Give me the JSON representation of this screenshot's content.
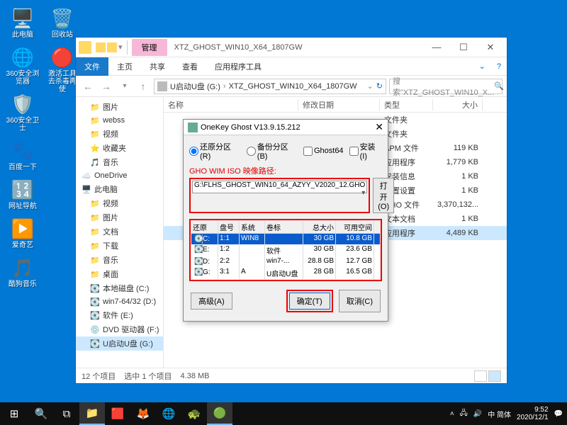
{
  "desktop": {
    "col1": [
      {
        "icon": "🖥️",
        "label": "此电脑"
      },
      {
        "icon": "🌐",
        "label": "360安全浏览器"
      },
      {
        "icon": "🛡️",
        "label": "360安全卫士"
      },
      {
        "icon": "🐾",
        "label": "百度一下"
      },
      {
        "icon": "🔢",
        "label": "网址导航"
      },
      {
        "icon": "▶️",
        "label": "爱奇艺"
      },
      {
        "icon": "🎵",
        "label": "酷狗音乐"
      }
    ],
    "col2": [
      {
        "icon": "🗑️",
        "label": "回收站"
      },
      {
        "icon": "🔴",
        "label": "激活工具去杀毒再使"
      }
    ]
  },
  "explorer": {
    "window_tab": "管理",
    "title": "XTZ_GHOST_WIN10_X64_1807GW",
    "ribbon": {
      "file": "文件",
      "tabs": [
        "主页",
        "共享",
        "查看",
        "应用程序工具"
      ]
    },
    "breadcrumb": [
      "U启动U盘 (G:)",
      "XTZ_GHOST_WIN10_X64_1807GW"
    ],
    "search_placeholder": "搜索\"XTZ_GHOST_WIN10_X...",
    "nav": [
      {
        "label": "图片",
        "ico": "folder",
        "indent": 1
      },
      {
        "label": "webss",
        "ico": "folder",
        "indent": 1
      },
      {
        "label": "视频",
        "ico": "folder",
        "indent": 1
      },
      {
        "label": "收藏夹",
        "ico": "star",
        "indent": 1
      },
      {
        "label": "音乐",
        "ico": "music",
        "indent": 1
      },
      {
        "label": "OneDrive",
        "ico": "cloud",
        "indent": 0,
        "group": true
      },
      {
        "label": "此电脑",
        "ico": "pc",
        "indent": 0,
        "group": true
      },
      {
        "label": "视频",
        "ico": "folder",
        "indent": 1
      },
      {
        "label": "图片",
        "ico": "folder",
        "indent": 1
      },
      {
        "label": "文档",
        "ico": "folder",
        "indent": 1
      },
      {
        "label": "下载",
        "ico": "folder",
        "indent": 1
      },
      {
        "label": "音乐",
        "ico": "folder",
        "indent": 1
      },
      {
        "label": "桌面",
        "ico": "folder",
        "indent": 1
      },
      {
        "label": "本地磁盘 (C:)",
        "ico": "disk",
        "indent": 1
      },
      {
        "label": "win7-64/32 (D:)",
        "ico": "disk",
        "indent": 1
      },
      {
        "label": "软件 (E:)",
        "ico": "disk",
        "indent": 1
      },
      {
        "label": "DVD 驱动器 (F:)",
        "ico": "dvd",
        "indent": 1
      },
      {
        "label": "U启动U盘 (G:)",
        "ico": "disk",
        "indent": 1,
        "selected": true
      }
    ],
    "columns": {
      "name": "名称",
      "date": "修改日期",
      "type": "类型",
      "size": "大小"
    },
    "files": [
      {
        "name": "",
        "date": "",
        "type": "文件夹",
        "size": ""
      },
      {
        "name": "",
        "date": "",
        "type": "文件夹",
        "size": ""
      },
      {
        "name": "",
        "date": "",
        "type": "APM 文件",
        "size": "119 KB"
      },
      {
        "name": "",
        "date": "",
        "type": "应用程序",
        "size": "1,779 KB"
      },
      {
        "name": "",
        "date": "",
        "type": "安装信息",
        "size": "1 KB"
      },
      {
        "name": "",
        "date": "",
        "type": "配置设置",
        "size": "1 KB"
      },
      {
        "name": "",
        "date": "",
        "type": "GHO 文件",
        "size": "3,370,132..."
      },
      {
        "name": "",
        "date": "",
        "type": "文本文档",
        "size": "1 KB"
      },
      {
        "name": "",
        "date": "",
        "type": "应用程序",
        "size": "4,489 KB",
        "selected": true
      }
    ],
    "status": {
      "count": "12 个项目",
      "selected": "选中 1 个项目",
      "size": "4.38 MB"
    }
  },
  "ghost": {
    "title": "OneKey Ghost V13.9.15.212",
    "radios": {
      "restore": "还原分区(R)",
      "backup": "备份分区(B)",
      "ghost64": "Ghost64",
      "install": "安装(I)"
    },
    "section_label": "GHO WIM ISO 映像路径:",
    "image_path": "G:\\FLHS_GHOST_WIN10_64_AZYY_V2020_12.GHO",
    "open_btn": "打开(O)",
    "table_headers": {
      "restore": "还原",
      "disk": "盘号",
      "sys": "系统",
      "vol": "卷标",
      "total": "总大小",
      "free": "可用空间"
    },
    "partitions": [
      {
        "drive": "C:",
        "disk": "1:1",
        "sys": "WIN8",
        "vol": "",
        "total": "30 GB",
        "free": "10.8 GB",
        "selected": true
      },
      {
        "drive": "E:",
        "disk": "1:2",
        "sys": "",
        "vol": "软件",
        "total": "30 GB",
        "free": "23.6 GB"
      },
      {
        "drive": "D:",
        "disk": "2:2",
        "sys": "",
        "vol": "win7-...",
        "total": "28.8 GB",
        "free": "12.7 GB"
      },
      {
        "drive": "G:",
        "disk": "3:1",
        "sys": "A",
        "vol": "U启动U盘",
        "total": "28 GB",
        "free": "16.5 GB"
      }
    ],
    "buttons": {
      "advanced": "高级(A)",
      "ok": "确定(T)",
      "cancel": "取消(C)"
    }
  },
  "taskbar": {
    "tray": {
      "ime": "中 简体",
      "time": "9:52",
      "date": "2020/12/1"
    }
  }
}
